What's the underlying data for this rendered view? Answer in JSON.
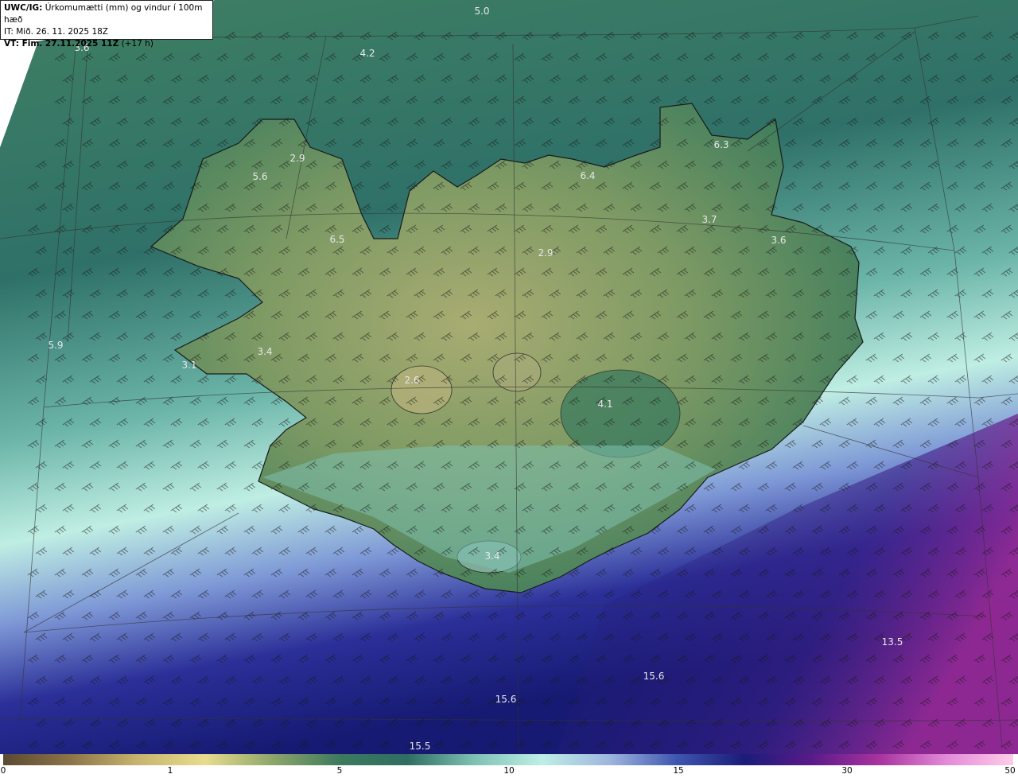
{
  "header": {
    "title_prefix": "UWC/IG:",
    "title_text": "Úrkomumætti (mm) og vindur í 100m hæð",
    "issue_time": "IT: Mið. 26. 11. 2025 18Z",
    "valid_prefix": "VT: Fim. 27.11.2025 11Z",
    "valid_offset": "(+17 h)"
  },
  "map": {
    "value_labels": [
      "5.0",
      "3.6",
      "4.2",
      "2.9",
      "5.6",
      "6.3",
      "6.4",
      "3.7",
      "3.6",
      "6.5",
      "2.9",
      "5.9",
      "3.4",
      "3.1",
      "2.6",
      "4.1",
      "3.4",
      "13.5",
      "15.6",
      "15.6",
      "15.5"
    ],
    "wind_barb_icon": "wind-barb-icon"
  },
  "colorbar": {
    "ticks": [
      "0",
      "1",
      "5",
      "10",
      "15",
      "30",
      "50"
    ],
    "colors": [
      "#5a4a32",
      "#8c7448",
      "#c8b46e",
      "#e8dc8e",
      "#8ea66a",
      "#3d7a5e",
      "#2f6e62",
      "#7ec2b4",
      "#bfeee6",
      "#9fb6e0",
      "#3f56b0",
      "#1a1c78",
      "#5a1a8a",
      "#a8329e",
      "#e28ad8",
      "#ffcce8"
    ]
  }
}
